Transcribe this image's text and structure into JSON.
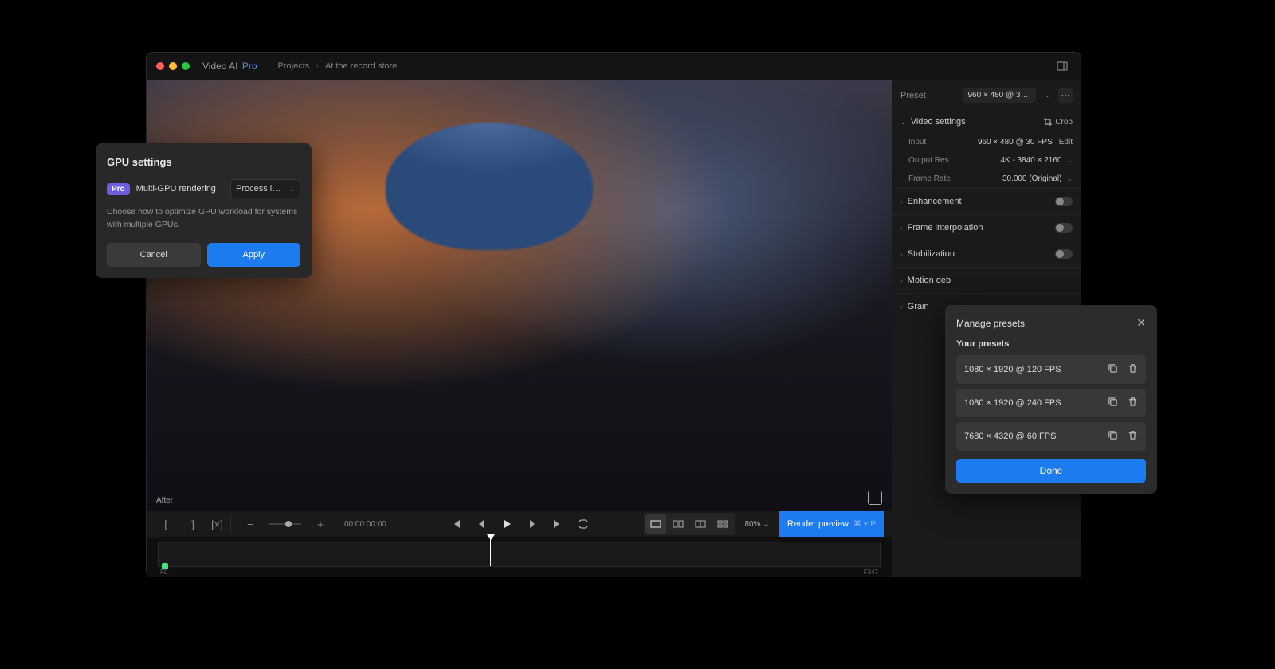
{
  "app": {
    "title": "Video AI",
    "edition": "Pro"
  },
  "breadcrumb": {
    "root": "Projects",
    "current": "At the record store"
  },
  "viewer": {
    "after_label": "After"
  },
  "transport": {
    "timecode": "00:00:00:00",
    "zoom": "80%",
    "render_label": "Render preview",
    "render_shortcut": "⌘ + P"
  },
  "timeline": {
    "start_frame": "F0",
    "end_frame": "F347"
  },
  "sidebar": {
    "preset": {
      "label": "Preset",
      "value": "960 × 480 @ 30 F…"
    },
    "video_settings_label": "Video settings",
    "crop_label": "Crop",
    "input": {
      "label": "Input",
      "value": "960 × 480 @ 30 FPS",
      "edit": "Edit"
    },
    "output_res": {
      "label": "Output Res",
      "value": "4K - 3840 × 2160"
    },
    "frame_rate": {
      "label": "Frame Rate",
      "value": "30.000 (Original)"
    },
    "toggles": {
      "enhancement": "Enhancement",
      "frame_interp": "Frame interpolation",
      "stabilization": "Stabilization",
      "motion_deb": "Motion deb",
      "grain": "Grain"
    }
  },
  "gpu_dialog": {
    "title": "GPU settings",
    "pro_badge": "Pro",
    "label": "Multi-GPU rendering",
    "select_value": "Process i…",
    "description": "Choose how to optimize GPU workload for systems with multiple GPUs.",
    "cancel": "Cancel",
    "apply": "Apply"
  },
  "presets_popover": {
    "title": "Manage presets",
    "subhead": "Your presets",
    "items": [
      "1080 × 1920 @ 120 FPS",
      "1080 × 1920 @ 240 FPS",
      "7680 × 4320 @ 60 FPS"
    ],
    "done": "Done"
  }
}
